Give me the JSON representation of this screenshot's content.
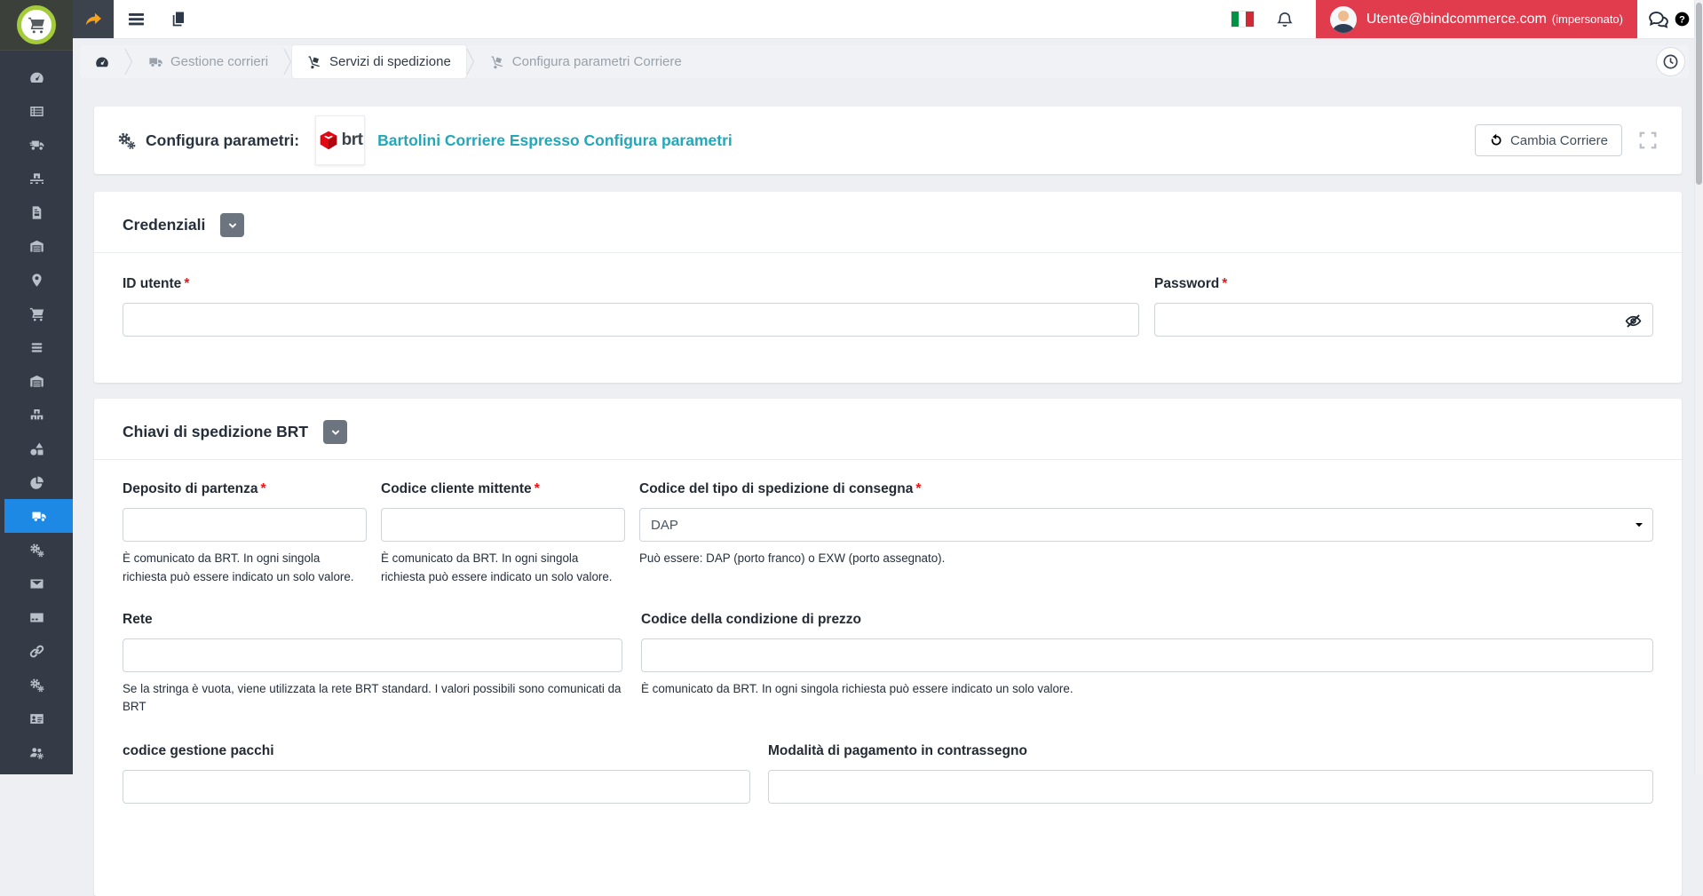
{
  "topbar": {
    "user_email": "Utente@bindcommerce.com",
    "user_mode": "(impersonato)",
    "icons": [
      "menu-toggle-arrow",
      "hamburger",
      "copy-pages",
      "italian-flag",
      "bell",
      "avatar",
      "comments",
      "question-circle"
    ]
  },
  "breadcrumb": {
    "items_icons": [
      "gauge",
      "truck",
      "dolly",
      "dolly"
    ],
    "home_label": "",
    "item1": "Gestione corrieri",
    "item2": "Servizi di spedizione",
    "item3": "Configura parametri Corriere"
  },
  "header": {
    "icon": "gears",
    "title": "Configura parametri:",
    "brt_logo_text": "brt",
    "courier_link": "Bartolini Corriere Espresso Configura parametri",
    "change_courier_label": "Cambia Corriere"
  },
  "required_marker": "*",
  "sections": {
    "credentials": {
      "title": "Credenziali",
      "fields": {
        "user_id": {
          "label": "ID utente",
          "required": true,
          "value": ""
        },
        "password": {
          "label": "Password",
          "required": true,
          "value": ""
        }
      }
    },
    "brt_keys": {
      "title": "Chiavi di spedizione BRT",
      "fields": {
        "departure_depot": {
          "label": "Deposito di partenza",
          "required": true,
          "value": "",
          "help": "È comunicato da BRT. In ogni singola richiesta può essere indicato un solo valore."
        },
        "sender_client_code": {
          "label": "Codice cliente mittente",
          "required": true,
          "value": "",
          "help": "È comunicato da BRT. In ogni singola richiesta può essere indicato un solo valore."
        },
        "delivery_shipment_type": {
          "label": "Codice del tipo di spedizione di consegna",
          "required": true,
          "value": "DAP",
          "help": "Può essere: DAP (porto franco) o EXW (porto assegnato)."
        },
        "network": {
          "label": "Rete",
          "value": "",
          "help": "Se la stringa è vuota, viene utilizzata la rete BRT standard. I valori possibili sono comunicati da BRT"
        },
        "price_condition_code": {
          "label": "Codice della condizione di prezzo",
          "value": "",
          "help": "È comunicato da BRT. In ogni singola richiesta può essere indicato un solo valore."
        },
        "parcel_management_code": {
          "label": "codice gestione pacchi",
          "value": ""
        },
        "cod_payment_mode": {
          "label": "Modalità di pagamento in contrassegno",
          "value": ""
        }
      }
    }
  },
  "sidebar": {
    "active_index": 13,
    "items": [
      {
        "icon": "dashboard",
        "symbol": "gauge"
      },
      {
        "icon": "orders-list",
        "symbol": "list"
      },
      {
        "icon": "shipping-fast",
        "symbol": "truck-fast"
      },
      {
        "icon": "pallet",
        "symbol": "pallet"
      },
      {
        "icon": "invoices",
        "symbol": "file-invoice"
      },
      {
        "icon": "warehouse",
        "symbol": "warehouse"
      },
      {
        "icon": "locations",
        "symbol": "location"
      },
      {
        "icon": "cart",
        "symbol": "cart"
      },
      {
        "icon": "listings",
        "symbol": "bars"
      },
      {
        "icon": "warehouse-alt",
        "symbol": "warehouse"
      },
      {
        "icon": "boxes",
        "symbol": "boxes"
      },
      {
        "icon": "shapes",
        "symbol": "shapes"
      },
      {
        "icon": "reports-pie",
        "symbol": "chart-pie"
      },
      {
        "icon": "couriers-truck",
        "symbol": "truck"
      },
      {
        "icon": "settings-gears",
        "symbol": "gears"
      },
      {
        "icon": "messages",
        "symbol": "envelope"
      },
      {
        "icon": "payments",
        "symbol": "credit-card"
      },
      {
        "icon": "connections-link",
        "symbol": "link"
      },
      {
        "icon": "services-gears",
        "symbol": "gears"
      },
      {
        "icon": "contacts-card",
        "symbol": "id-card"
      },
      {
        "icon": "users-gear",
        "symbol": "users-gear"
      }
    ]
  },
  "colors": {
    "sidebar_bg": "#353b46",
    "active_blue": "#1e88e5",
    "user_bar_red": "#e13b4e",
    "brand_teal": "#23a7b9",
    "brt_red": "#e30613",
    "arrow_orange": "#f6a21d",
    "flag_green": "#009246",
    "flag_red": "#ce2b37"
  }
}
